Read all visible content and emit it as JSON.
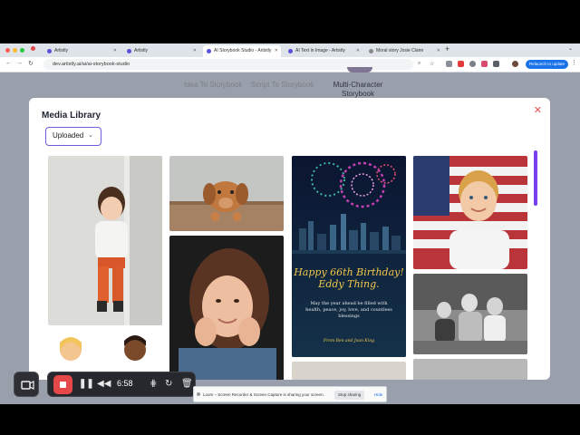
{
  "browser": {
    "tabs": [
      {
        "title": "Artistly"
      },
      {
        "title": "Artistly"
      },
      {
        "title": "AI Storybook Studio - Artistly",
        "active": true
      },
      {
        "title": "AI Text in Image - Artistly"
      },
      {
        "title": "Moral story Josie Claire"
      }
    ],
    "url": "dev.artistly.ai/ai/ai-storybook-studio",
    "relaunch_label": "Relaunch to update"
  },
  "page": {
    "tabs": [
      {
        "label": "Idea To Storybook"
      },
      {
        "label": "Script To Storybook"
      },
      {
        "label": "Multi-Character Storybook",
        "active": true
      }
    ]
  },
  "modal": {
    "title": "Media Library",
    "close_icon": "close-icon",
    "filter": {
      "selected": "Uploaded"
    },
    "items": [
      {
        "name": "toddler-photo"
      },
      {
        "name": "puppy-photo"
      },
      {
        "name": "birthday-card",
        "lines": [
          "Happy 66th Birthday!",
          "Eddy Thing.",
          "May the year ahead be filled with health, peace, joy, love, and countless blessings",
          "From Ben and Joan King"
        ]
      },
      {
        "name": "boy-flag-photo"
      },
      {
        "name": "girl-portrait-photo"
      },
      {
        "name": "family-bw-photo"
      }
    ]
  },
  "recorder": {
    "timer": "6:58"
  },
  "share_notice": {
    "message": "Loom – Screen Recorder & Screen Capture is sharing your screen.",
    "stop_label": "Stop sharing",
    "hide_label": "Hide"
  },
  "colors": {
    "accent": "#6b5fe0",
    "scrollbar": "#7a3ff0",
    "record": "#e54848",
    "close": "#e55050"
  }
}
